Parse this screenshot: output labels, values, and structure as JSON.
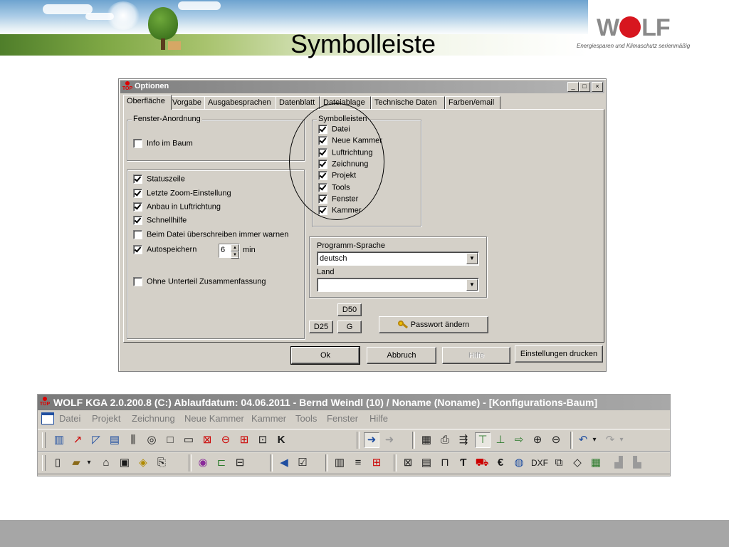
{
  "slide": {
    "title": "Symbolleiste",
    "logo_parts": [
      "W",
      "LF"
    ],
    "tagline": "Energiesparen und Klimaschutz serienmäßig"
  },
  "dialog": {
    "title": "Optionen",
    "app_icon": "TOP",
    "window_buttons": [
      "_",
      "□",
      "×"
    ],
    "tabs": [
      {
        "label": "Oberfläche",
        "active": true
      },
      {
        "label": "Vorgabe"
      },
      {
        "label": "Ausgabesprachen"
      },
      {
        "label": "Datenblatt"
      },
      {
        "label": "Dateiablage"
      },
      {
        "label": "Technische Daten"
      },
      {
        "label": "Farben/email"
      }
    ],
    "fenster": {
      "legend": "Fenster-Anordnung",
      "info_im_baum": {
        "label": "Info im Baum",
        "checked": false
      }
    },
    "options": [
      {
        "label": "Statuszeile",
        "checked": true
      },
      {
        "label": "Letzte Zoom-Einstellung",
        "checked": true
      },
      {
        "label": "Anbau in Luftrichtung",
        "checked": true
      },
      {
        "label": "Schnellhilfe",
        "checked": true
      },
      {
        "label": "Beim Datei überschreiben immer warnen",
        "checked": false
      },
      {
        "label": "Autospeichern",
        "checked": true
      },
      {
        "label": "Ohne Unterteil Zusammenfassung",
        "checked": false
      }
    ],
    "autosave_value": "6",
    "autosave_unit": "min",
    "symbolleisten": {
      "legend": "Symbolleisten",
      "items": [
        {
          "label": "Datei",
          "checked": true
        },
        {
          "label": "Neue Kammer",
          "checked": true
        },
        {
          "label": "Luftrichtung",
          "checked": true
        },
        {
          "label": "Zeichnung",
          "checked": true
        },
        {
          "label": "Projekt",
          "checked": true
        },
        {
          "label": "Tools",
          "checked": true
        },
        {
          "label": "Fenster",
          "checked": true
        },
        {
          "label": "Kammer",
          "checked": true
        }
      ]
    },
    "programm_sprache": {
      "label": "Programm-Sprache",
      "value": "deutsch"
    },
    "land": {
      "label": "Land",
      "value": ""
    },
    "buttons": {
      "d50": "D50",
      "d25": "D25",
      "g": "G",
      "passwort": "Passwort ändern",
      "ok": "Ok",
      "abbruch": "Abbruch",
      "hilfe": "Hilfe",
      "einstellungen": "Einstellungen drucken"
    }
  },
  "app": {
    "title": "WOLF KGA 2.0.200.8 (C:) Ablaufdatum: 04.06.2011 - Bernd Weindl (10) / Noname (Noname) - [Konfigurations-Baum]",
    "app_icon": "TOP",
    "menu": [
      "Datei",
      "Projekt",
      "Zeichnung",
      "Neue Kammer",
      "Kammer",
      "Tools",
      "Fenster",
      "Hilfe"
    ],
    "toolbar1_glyphs": [
      "▥",
      "↗",
      "◸",
      "▤",
      "⫼",
      "◎",
      "□",
      "▭",
      "⊠",
      "⊖",
      "⊞",
      "⊡",
      "K",
      "➜",
      "➜",
      "▦",
      "⎙",
      "⇶",
      "⊤",
      "⊥",
      "⇨",
      "⊕",
      "⊖",
      "↶",
      "▾",
      "↷",
      "▾"
    ],
    "toolbar2_glyphs": [
      "▯",
      "▰",
      "▾",
      "⌂",
      "▣",
      "◈",
      "⎘",
      "◉",
      "⊏",
      "⊟",
      "◀",
      "☑",
      "▥",
      "≡",
      "⊞",
      "⊠",
      "▤",
      "⊓",
      "Ƭ",
      "⛟",
      "€",
      "◍",
      "DXF",
      "⧉",
      "◇",
      "▦",
      "▟",
      "▙"
    ]
  }
}
